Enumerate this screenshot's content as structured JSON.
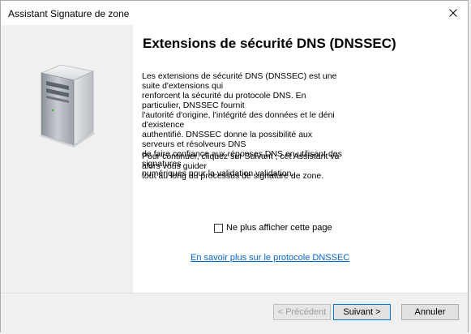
{
  "window": {
    "title": "Assistant Signature de zone"
  },
  "side_panel": {
    "icon": "server-tower-icon"
  },
  "content": {
    "heading": "Extensions de sécurité DNS (DNSSEC)",
    "paragraph1_lines": [
      "Les extensions de sécurité DNS (DNSSEC) est une suite d'extensions qui",
      "renforcent la sécurité du protocole DNS. En particulier, DNSSEC fournit",
      "l'autorité d'origine, l'intégrité des données et le déni d'existence",
      "authentifié. DNSSEC donne la possibilité aux serveurs et résolveurs DNS",
      "de faire confiance aux réponses DNS en utilisant des signatures",
      "numériques pour la validation validation."
    ],
    "paragraph2_lines": [
      "Pour continuer, cliquez sur Suivant ; cet Assistant va alors vous guider",
      "tout au long du processus de signature de zone."
    ],
    "checkbox_label": "Ne plus afficher cette page",
    "checkbox_checked": false,
    "help_link": "En savoir plus sur le protocole DNSSEC"
  },
  "footer": {
    "prev_label": "< Précédent",
    "next_label": "Suivant >",
    "cancel_label": "Annuler"
  },
  "colors": {
    "accent": "#0078d7",
    "link": "#0066cc",
    "panel_bg": "#f0f0f0"
  }
}
